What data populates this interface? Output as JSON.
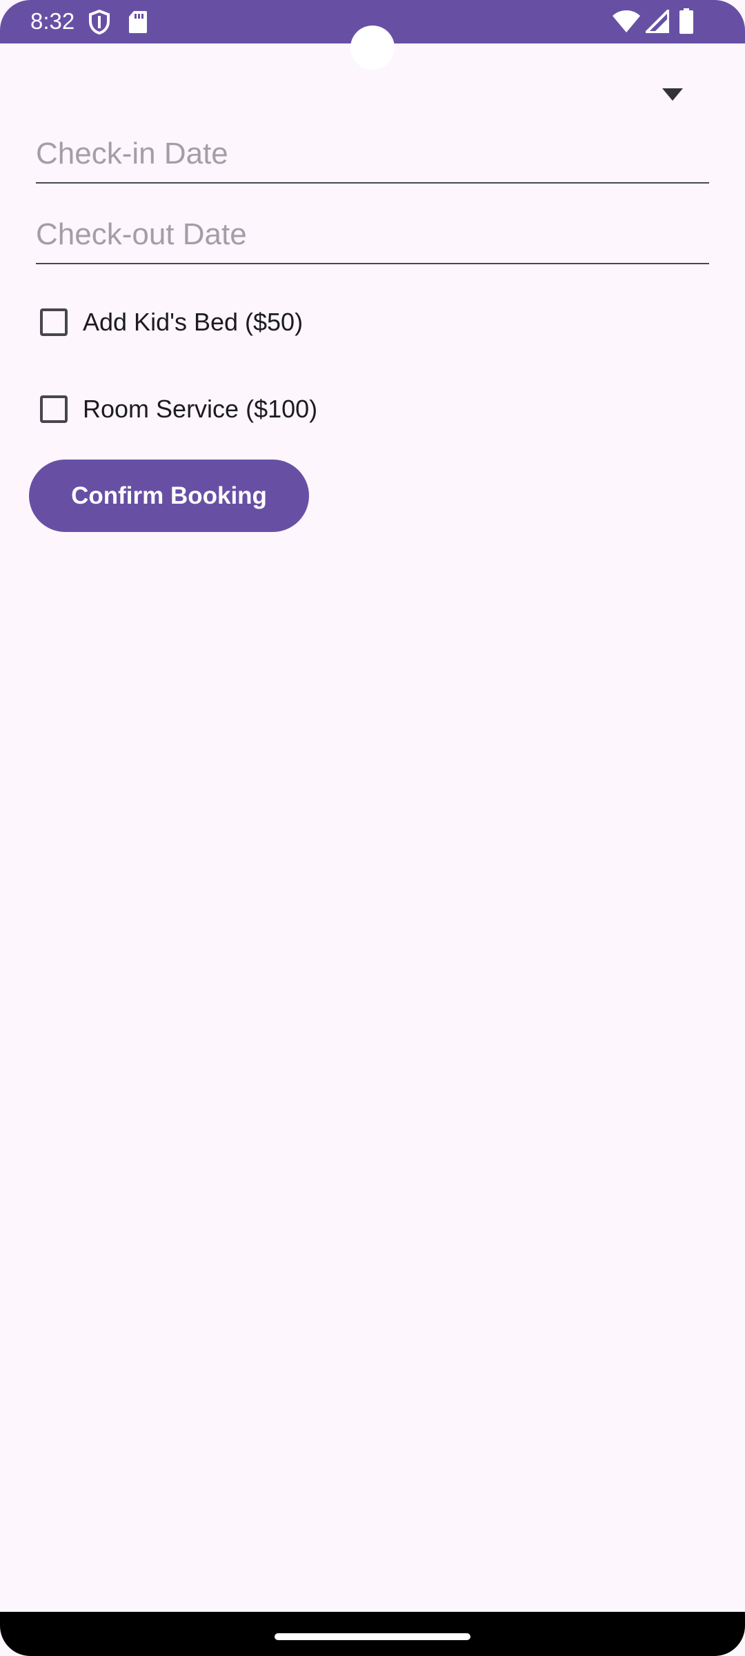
{
  "status_bar": {
    "time": "8:32",
    "icons": [
      "shield-icon",
      "sd-card-icon",
      "wifi-icon",
      "signal-icon",
      "battery-icon"
    ],
    "color": "#6750a4"
  },
  "form": {
    "dropdown_icon": "dropdown-arrow-icon",
    "checkin": {
      "placeholder": "Check-in Date",
      "value": ""
    },
    "checkout": {
      "placeholder": "Check-out Date",
      "value": ""
    },
    "options": [
      {
        "label": "Add Kid's Bed ($50)",
        "checked": false
      },
      {
        "label": "Room Service ($100)",
        "checked": false
      }
    ],
    "confirm_label": "Confirm Booking"
  },
  "colors": {
    "accent": "#6750a4",
    "background": "#fdf6fd",
    "text": "#1d1b20"
  }
}
